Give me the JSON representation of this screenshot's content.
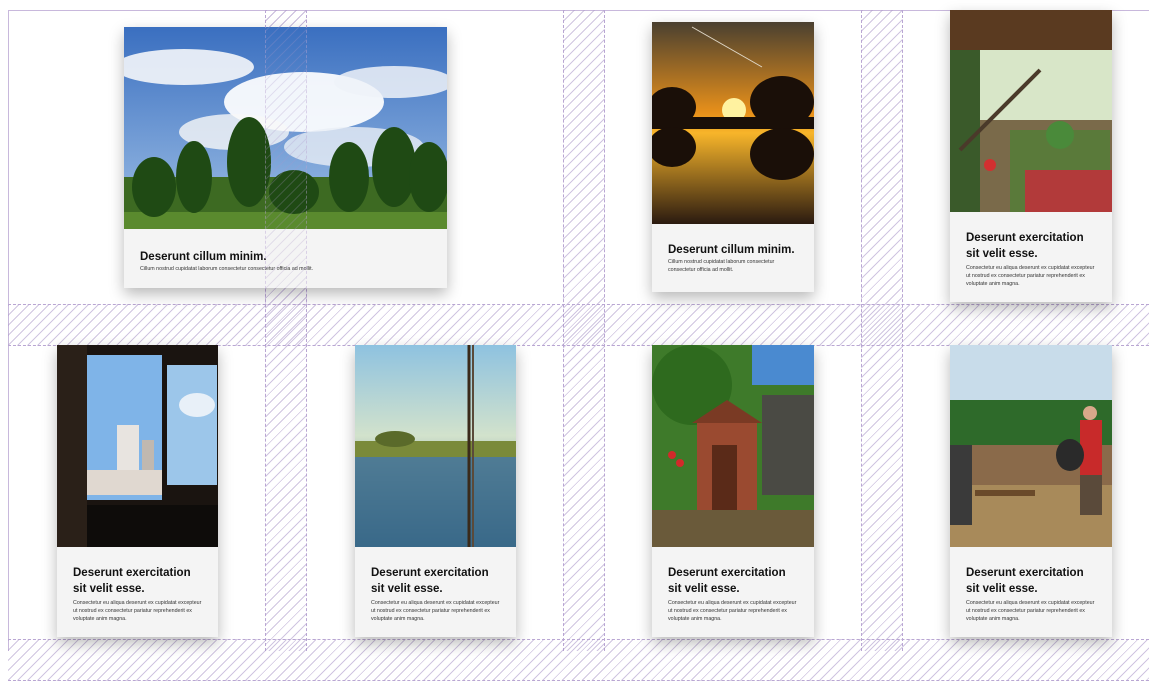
{
  "cards": [
    {
      "title": "Deserunt cillum minim.",
      "desc": "Cillum nostrud cupidatat laborum consectetur consectetur officia ad mollit.",
      "image": "landscape-trees-clouds"
    },
    {
      "title": "Deserunt cillum minim.",
      "desc": "Cillum nostrud cupidatat laborum consectetur consectetur officia ad mollit.",
      "image": "sunset-lake-trees"
    },
    {
      "title": "Deserunt exercitation sit velit esse.",
      "desc": "Consectetur eu aliqua deserunt ex cupidatat excepteur ut nostrud ex consectetur pariatur reprehenderit ex voluptate anim magna.",
      "image": "garden-pergola"
    },
    {
      "title": "Deserunt exercitation sit velit esse.",
      "desc": "Consectetur eu aliqua deserunt ex cupidatat excepteur ut nostrud ex consectetur pariatur reprehenderit ex voluptate anim magna.",
      "image": "window-view-buildings"
    },
    {
      "title": "Deserunt exercitation sit velit esse.",
      "desc": "Consectetur eu aliqua deserunt ex cupidatat excepteur ut nostrud ex consectetur pariatur reprehenderit ex voluptate anim magna.",
      "image": "river-reflection-rope"
    },
    {
      "title": "Deserunt exercitation sit velit esse.",
      "desc": "Consectetur eu aliqua deserunt ex cupidatat excepteur ut nostrud ex consectetur pariatur reprehenderit ex voluptate anim magna.",
      "image": "brick-shed-garden"
    },
    {
      "title": "Deserunt exercitation sit velit esse.",
      "desc": "Consectetur eu aliqua deserunt ex cupidatat excepteur ut nostrud ex consectetur pariatur reprehenderit ex voluptate anim magna.",
      "image": "field-barbecue-people"
    }
  ]
}
